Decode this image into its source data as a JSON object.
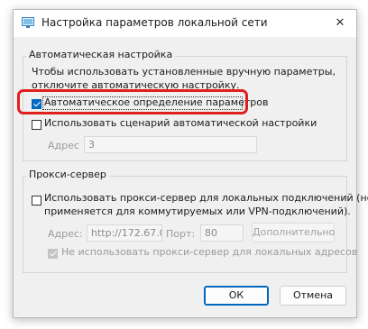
{
  "window": {
    "title": "Настройка параметров локальной сети",
    "close_glyph": "✕"
  },
  "auto_config": {
    "group_label": "Автоматическая настройка",
    "description_line1": "Чтобы использовать установленные вручную параметры,",
    "description_line2": "отключите автоматическую настройку.",
    "auto_detect": {
      "label": "Автоматическое определение параметров",
      "checked": true
    },
    "use_script": {
      "label": "Использовать сценарий автоматической настройки",
      "checked": false
    },
    "address_label": "Адрес",
    "address_value": "3"
  },
  "proxy": {
    "group_label": "Прокси-сервер",
    "use_proxy_line1": "Использовать прокси-сервер для локальных подключений (не",
    "use_proxy_line2": "применяется для коммутируемых или VPN-подключений).",
    "use_proxy_checked": false,
    "address_label": "Адрес:",
    "address_value": "http://172.67.0.",
    "port_label": "Порт:",
    "port_value": "80",
    "advanced_label": "Дополнительно",
    "bypass_label": "Не использовать прокси-сервер для локальных адресов",
    "bypass_checked": true
  },
  "buttons": {
    "ok": "ОК",
    "cancel": "Отмена"
  },
  "colors": {
    "accent": "#0067c0",
    "highlight": "#e0201e"
  }
}
